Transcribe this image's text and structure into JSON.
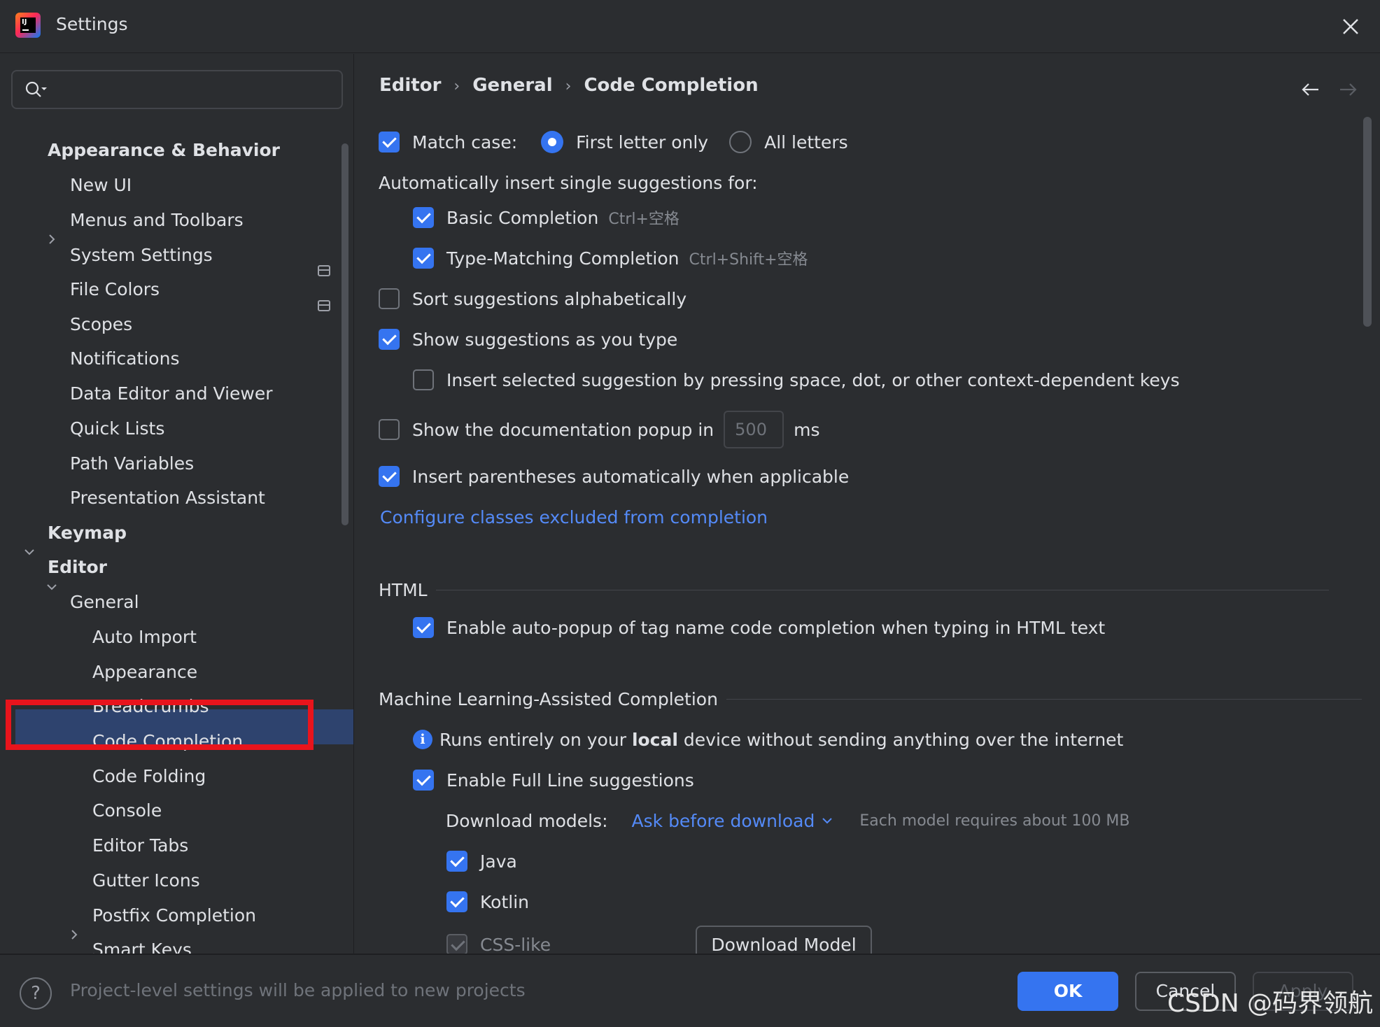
{
  "window": {
    "title": "Settings",
    "logo_text": "IJ"
  },
  "search": {
    "value": "",
    "placeholder": ""
  },
  "tree": {
    "items": [
      {
        "label": "Appearance & Behavior"
      },
      {
        "label": "New UI"
      },
      {
        "label": "Menus and Toolbars"
      },
      {
        "label": "System Settings"
      },
      {
        "label": "File Colors"
      },
      {
        "label": "Scopes"
      },
      {
        "label": "Notifications"
      },
      {
        "label": "Data Editor and Viewer"
      },
      {
        "label": "Quick Lists"
      },
      {
        "label": "Path Variables"
      },
      {
        "label": "Presentation Assistant"
      },
      {
        "label": "Keymap"
      },
      {
        "label": "Editor"
      },
      {
        "label": "General"
      },
      {
        "label": "Auto Import"
      },
      {
        "label": "Appearance"
      },
      {
        "label": "Breadcrumbs"
      },
      {
        "label": "Code Completion"
      },
      {
        "label": "Code Folding"
      },
      {
        "label": "Console"
      },
      {
        "label": "Editor Tabs"
      },
      {
        "label": "Gutter Icons"
      },
      {
        "label": "Postfix Completion"
      },
      {
        "label": "Smart Keys"
      }
    ],
    "selected": "Code Completion"
  },
  "breadcrumb": {
    "items": [
      "Editor",
      "General",
      "Code Completion"
    ],
    "separator": "›"
  },
  "settings": {
    "match_case": {
      "label": "Match case:",
      "checked": true,
      "options": [
        "First letter only",
        "All letters"
      ],
      "selected": "First letter only"
    },
    "auto_insert_heading": "Automatically insert single suggestions for:",
    "basic_completion": {
      "label": "Basic Completion",
      "shortcut": "Ctrl+空格",
      "checked": true
    },
    "type_matching": {
      "label": "Type-Matching Completion",
      "shortcut": "Ctrl+Shift+空格",
      "checked": true
    },
    "sort_alpha": {
      "label": "Sort suggestions alphabetically",
      "checked": false
    },
    "show_as_type": {
      "label": "Show suggestions as you type",
      "checked": true
    },
    "insert_selected": {
      "label": "Insert selected suggestion by pressing space, dot, or other context-dependent keys",
      "checked": false
    },
    "doc_popup": {
      "label": "Show the documentation popup in",
      "value": "500",
      "unit": "ms",
      "checked": false
    },
    "insert_parens": {
      "label": "Insert parentheses automatically when applicable",
      "checked": true
    },
    "configure_link": "Configure classes excluded from completion",
    "html_section": "HTML",
    "html_autopopup": {
      "label": "Enable auto-popup of tag name code completion when typing in HTML text",
      "checked": true
    },
    "ml_section": "Machine Learning-Assisted Completion",
    "ml_info": {
      "before": "Runs entirely on your ",
      "bold": "local",
      "after": " device without sending anything over the internet"
    },
    "full_line": {
      "label": "Enable Full Line suggestions",
      "checked": true
    },
    "download_models": {
      "label": "Download models:",
      "value": "Ask before download",
      "hint": "Each model requires about 100 MB"
    },
    "java": {
      "label": "Java",
      "checked": true
    },
    "kotlin": {
      "label": "Kotlin",
      "checked": true
    },
    "css_like": {
      "label": "CSS-like",
      "checked": true,
      "disabled": true
    },
    "download_button": "Download Model"
  },
  "footer": {
    "help": "?",
    "note": "Project-level settings will be applied to new projects",
    "ok": "OK",
    "cancel": "Cancel",
    "apply": "Apply",
    "watermark": "CSDN @码界领航"
  },
  "colors": {
    "accent": "#3574f0",
    "link": "#548af7",
    "highlight": "#e8141c",
    "selection": "#2e436e",
    "background": "#2b2d30"
  }
}
